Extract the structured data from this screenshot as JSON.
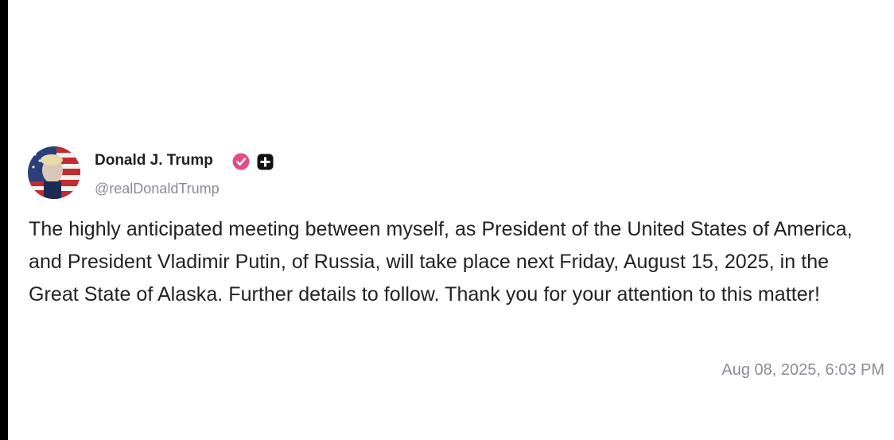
{
  "post": {
    "author": {
      "display_name": "Donald J. Trump",
      "handle": "@realDonaldTrump",
      "avatar_icon": "profile-avatar",
      "verified_icon": "verified-badge-icon",
      "extra_icon": "plus-badge-icon"
    },
    "body": "The highly anticipated meeting between myself, as President of the United States of America, and President Vladimir Putin, of Russia, will take place next Friday, August 15, 2025, in the Great State of Alaska. Further details to follow. Thank you for your attention to this matter!",
    "timestamp": "Aug 08, 2025, 6:03 PM"
  },
  "colors": {
    "verified_badge": "#e84a86",
    "name_text": "#1f1f24",
    "muted_text": "#8b8b95",
    "body_text": "#222226"
  }
}
